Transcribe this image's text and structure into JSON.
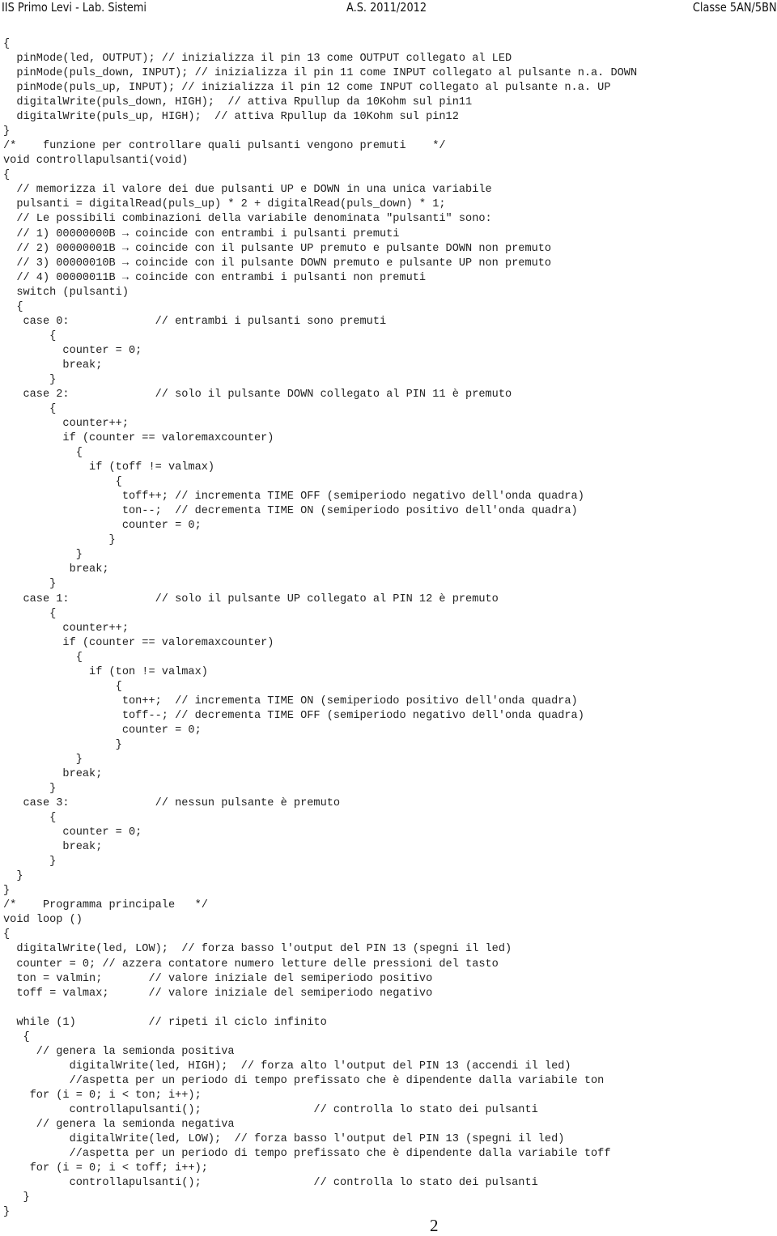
{
  "header": {
    "school": "IIS Primo Levi - Lab. Sistemi",
    "year": "A.S. 2011/2012",
    "class": "Classe 5AN/5BN"
  },
  "code_lines": [
    "{",
    "  pinMode(led, OUTPUT); // inizializza il pin 13 come OUTPUT collegato al LED",
    "  pinMode(puls_down, INPUT); // inizializza il pin 11 come INPUT collegato al pulsante n.a. DOWN",
    "  pinMode(puls_up, INPUT); // inizializza il pin 12 come INPUT collegato al pulsante n.a. UP",
    "  digitalWrite(puls_down, HIGH);  // attiva Rpullup da 10Kohm sul pin11",
    "  digitalWrite(puls_up, HIGH);  // attiva Rpullup da 10Kohm sul pin12",
    "}",
    "/*    funzione per controllare quali pulsanti vengono premuti    */",
    "void controllapulsanti(void)",
    "{",
    "  // memorizza il valore dei due pulsanti UP e DOWN in una unica variabile",
    "  pulsanti = digitalRead(puls_up) * 2 + digitalRead(puls_down) * 1;",
    "  // Le possibili combinazioni della variabile denominata \"pulsanti\" sono:",
    "  // 1) 00000000B → coincide con entrambi i pulsanti premuti",
    "  // 2) 00000001B → coincide con il pulsante UP premuto e pulsante DOWN non premuto",
    "  // 3) 00000010B → coincide con il pulsante DOWN premuto e pulsante UP non premuto",
    "  // 4) 00000011B → coincide con entrambi i pulsanti non premuti",
    "  switch (pulsanti)",
    "  {",
    "   case 0:             // entrambi i pulsanti sono premuti",
    "       {",
    "         counter = 0;",
    "         break;",
    "       }",
    "   case 2:             // solo il pulsante DOWN collegato al PIN 11 è premuto",
    "       {",
    "         counter++;",
    "         if (counter == valoremaxcounter)",
    "           {",
    "             if (toff != valmax)",
    "                 {",
    "                  toff++; // incrementa TIME OFF (semiperiodo negativo dell'onda quadra)",
    "                  ton--;  // decrementa TIME ON (semiperiodo positivo dell'onda quadra)",
    "                  counter = 0;",
    "                }",
    "           }",
    "          break;",
    "       }",
    "   case 1:             // solo il pulsante UP collegato al PIN 12 è premuto",
    "       {",
    "         counter++;",
    "         if (counter == valoremaxcounter)",
    "           {",
    "             if (ton != valmax)",
    "                 {",
    "                  ton++;  // incrementa TIME ON (semiperiodo positivo dell'onda quadra)",
    "                  toff--; // decrementa TIME OFF (semiperiodo negativo dell'onda quadra)",
    "                  counter = 0;",
    "                 }",
    "           }",
    "         break;",
    "       }",
    "   case 3:             // nessun pulsante è premuto",
    "       {",
    "         counter = 0;",
    "         break;",
    "       }",
    "  }",
    "}",
    "/*    Programma principale   */",
    "void loop ()",
    "{",
    "  digitalWrite(led, LOW);  // forza basso l'output del PIN 13 (spegni il led)",
    "  counter = 0; // azzera contatore numero letture delle pressioni del tasto",
    "  ton = valmin;       // valore iniziale del semiperiodo positivo",
    "  toff = valmax;      // valore iniziale del semiperiodo negativo",
    "",
    "  while (1)           // ripeti il ciclo infinito",
    "   {",
    "     // genera la semionda positiva",
    "          digitalWrite(led, HIGH);  // forza alto l'output del PIN 13 (accendi il led)",
    "          //aspetta per un periodo di tempo prefissato che è dipendente dalla variabile ton",
    "    for (i = 0; i < ton; i++);",
    "          controllapulsanti();                 // controlla lo stato dei pulsanti",
    "     // genera la semionda negativa",
    "          digitalWrite(led, LOW);  // forza basso l'output del PIN 13 (spegni il led)",
    "          //aspetta per un periodo di tempo prefissato che è dipendente dalla variabile toff",
    "    for (i = 0; i < toff; i++);",
    "          controllapulsanti();                 // controlla lo stato dei pulsanti",
    "   }",
    "}"
  ],
  "page_number": "2"
}
